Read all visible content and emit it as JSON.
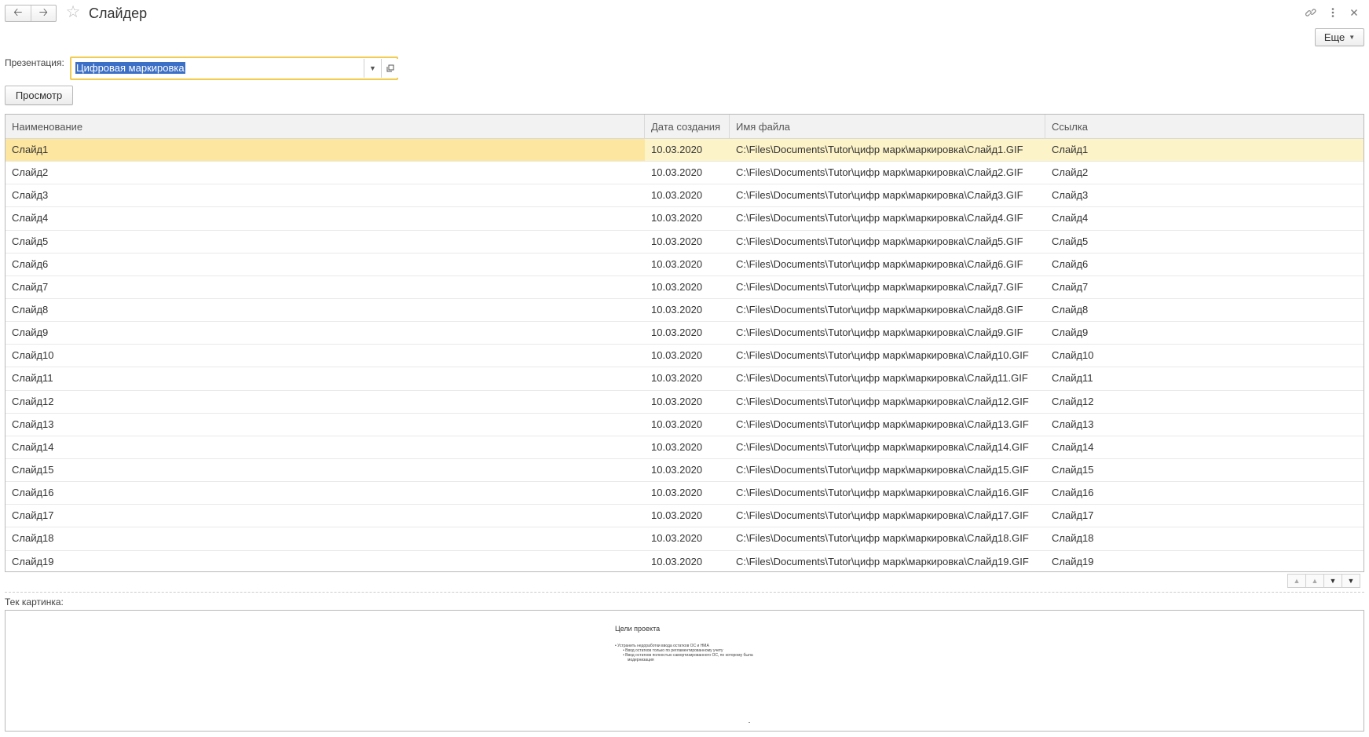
{
  "window": {
    "title": "Слайдер",
    "back_icon": "arrow-left",
    "forward_icon": "arrow-right",
    "favorite_icon": "star-outline",
    "link_icon": "link",
    "menu_icon": "kebab-menu",
    "close_icon": "close-x"
  },
  "toolbar": {
    "more_label": "Еще"
  },
  "presentation": {
    "label": "Презентация:",
    "value": "Цифровая маркировка"
  },
  "actions": {
    "view_label": "Просмотр"
  },
  "table": {
    "columns": [
      "Наименование",
      "Дата создания",
      "Имя файла",
      "Ссылка"
    ],
    "rows": [
      [
        "Слайд1",
        "10.03.2020",
        "C:\\Files\\Documents\\Tutor\\цифр марк\\маркировка\\Слайд1.GIF",
        "Слайд1"
      ],
      [
        "Слайд2",
        "10.03.2020",
        "C:\\Files\\Documents\\Tutor\\цифр марк\\маркировка\\Слайд2.GIF",
        "Слайд2"
      ],
      [
        "Слайд3",
        "10.03.2020",
        "C:\\Files\\Documents\\Tutor\\цифр марк\\маркировка\\Слайд3.GIF",
        "Слайд3"
      ],
      [
        "Слайд4",
        "10.03.2020",
        "C:\\Files\\Documents\\Tutor\\цифр марк\\маркировка\\Слайд4.GIF",
        "Слайд4"
      ],
      [
        "Слайд5",
        "10.03.2020",
        "C:\\Files\\Documents\\Tutor\\цифр марк\\маркировка\\Слайд5.GIF",
        "Слайд5"
      ],
      [
        "Слайд6",
        "10.03.2020",
        "C:\\Files\\Documents\\Tutor\\цифр марк\\маркировка\\Слайд6.GIF",
        "Слайд6"
      ],
      [
        "Слайд7",
        "10.03.2020",
        "C:\\Files\\Documents\\Tutor\\цифр марк\\маркировка\\Слайд7.GIF",
        "Слайд7"
      ],
      [
        "Слайд8",
        "10.03.2020",
        "C:\\Files\\Documents\\Tutor\\цифр марк\\маркировка\\Слайд8.GIF",
        "Слайд8"
      ],
      [
        "Слайд9",
        "10.03.2020",
        "C:\\Files\\Documents\\Tutor\\цифр марк\\маркировка\\Слайд9.GIF",
        "Слайд9"
      ],
      [
        "Слайд10",
        "10.03.2020",
        "C:\\Files\\Documents\\Tutor\\цифр марк\\маркировка\\Слайд10.GIF",
        "Слайд10"
      ],
      [
        "Слайд11",
        "10.03.2020",
        "C:\\Files\\Documents\\Tutor\\цифр марк\\маркировка\\Слайд11.GIF",
        "Слайд11"
      ],
      [
        "Слайд12",
        "10.03.2020",
        "C:\\Files\\Documents\\Tutor\\цифр марк\\маркировка\\Слайд12.GIF",
        "Слайд12"
      ],
      [
        "Слайд13",
        "10.03.2020",
        "C:\\Files\\Documents\\Tutor\\цифр марк\\маркировка\\Слайд13.GIF",
        "Слайд13"
      ],
      [
        "Слайд14",
        "10.03.2020",
        "C:\\Files\\Documents\\Tutor\\цифр марк\\маркировка\\Слайд14.GIF",
        "Слайд14"
      ],
      [
        "Слайд15",
        "10.03.2020",
        "C:\\Files\\Documents\\Tutor\\цифр марк\\маркировка\\Слайд15.GIF",
        "Слайд15"
      ],
      [
        "Слайд16",
        "10.03.2020",
        "C:\\Files\\Documents\\Tutor\\цифр марк\\маркировка\\Слайд16.GIF",
        "Слайд16"
      ],
      [
        "Слайд17",
        "10.03.2020",
        "C:\\Files\\Documents\\Tutor\\цифр марк\\маркировка\\Слайд17.GIF",
        "Слайд17"
      ],
      [
        "Слайд18",
        "10.03.2020",
        "C:\\Files\\Documents\\Tutor\\цифр марк\\маркировка\\Слайд18.GIF",
        "Слайд18"
      ],
      [
        "Слайд19",
        "10.03.2020",
        "C:\\Files\\Documents\\Tutor\\цифр марк\\маркировка\\Слайд19.GIF",
        "Слайд19"
      ]
    ],
    "selected_row": 0
  },
  "picture": {
    "label": "Тек картинка:",
    "slide_title": "Цели проекта",
    "slide_lines": [
      "• Устранить недоработки ввода остатков ОС и НМА",
      "• Ввод остатков только по регламентированному учету",
      "• Ввод остатков полностью самортизированного ОС, по которому была",
      "модернизация"
    ]
  },
  "colors": {
    "accent_border": "#f1cc4f",
    "selected_row": "#fdf3c8",
    "selected_cell": "#fde69f",
    "text_selection": "#3c6fc6"
  }
}
